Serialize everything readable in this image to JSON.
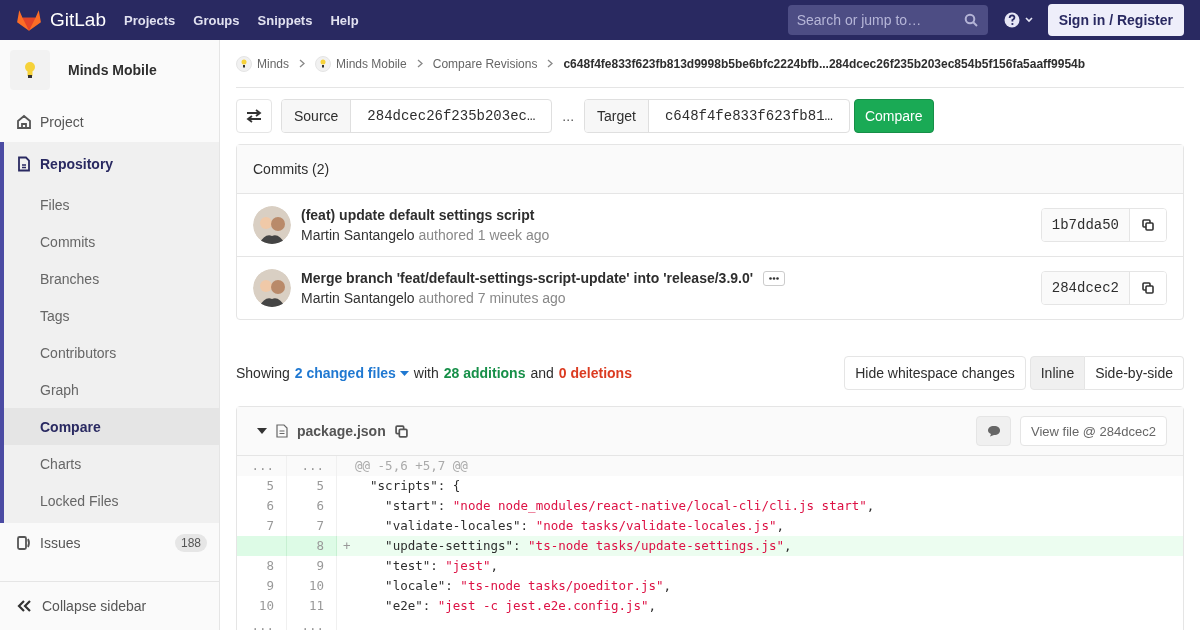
{
  "navbar": {
    "brand": "GitLab",
    "links": [
      "Projects",
      "Groups",
      "Snippets",
      "Help"
    ],
    "search": {
      "placeholder": "Search or jump to…"
    },
    "sign_in": "Sign in / Register"
  },
  "sidebar": {
    "project": "Minds Mobile",
    "items": [
      {
        "label": "Project",
        "selected": false
      },
      {
        "label": "Repository",
        "selected": true,
        "children": [
          {
            "label": "Files",
            "selected": false
          },
          {
            "label": "Commits",
            "selected": false
          },
          {
            "label": "Branches",
            "selected": false
          },
          {
            "label": "Tags",
            "selected": false
          },
          {
            "label": "Contributors",
            "selected": false
          },
          {
            "label": "Graph",
            "selected": false
          },
          {
            "label": "Compare",
            "selected": true
          },
          {
            "label": "Charts",
            "selected": false
          },
          {
            "label": "Locked Files",
            "selected": false
          }
        ]
      },
      {
        "label": "Issues",
        "selected": false,
        "count": "188"
      }
    ],
    "collapse": "Collapse sidebar"
  },
  "breadcrumbs": [
    {
      "label": "Minds",
      "kind": "project"
    },
    {
      "label": "Minds Mobile",
      "kind": "project"
    },
    {
      "label": "Compare Revisions",
      "kind": "link"
    },
    {
      "label": "c648f4fe833f623fb813d9998b5be6bfc2224bfb...284dcec26f235b203ec854b5f156fa5aaff9954b",
      "kind": "current"
    }
  ],
  "compare": {
    "source_label": "Source",
    "source_value": "284dcec26f235b203ec…",
    "separator": "...",
    "target_label": "Target",
    "target_value": "c648f4fe833f623fb81…",
    "button": "Compare"
  },
  "commits": {
    "title": "Commits (2)",
    "items": [
      {
        "title": "(feat) update default settings script",
        "author": "Martin Santangelo",
        "verb": "authored",
        "time": "1 week ago",
        "sha": "1b7dda50",
        "has_more": false
      },
      {
        "title": "Merge branch 'feat/default-settings-script-update' into 'release/3.9.0'",
        "author": "Martin Santangelo",
        "verb": "authored",
        "time": "7 minutes ago",
        "sha": "284dcec2",
        "has_more": true
      }
    ]
  },
  "summary": {
    "showing": "Showing",
    "files": "2 changed files",
    "with": "with",
    "additions": "28 additions",
    "and": "and",
    "deletions": "0 deletions"
  },
  "whitespace_button": "Hide whitespace changes",
  "view_modes": [
    {
      "label": "Inline",
      "selected": true
    },
    {
      "label": "Side-by-side",
      "selected": false
    }
  ],
  "file": {
    "name": "package.json",
    "expanded": true,
    "view_file": "View file @ 284dcec2",
    "lines": [
      {
        "kind": "hunk",
        "old": "...",
        "new": "...",
        "parts": [
          {
            "kind": "plain",
            "text": "@@ -5,6 +5,7 @@"
          }
        ]
      },
      {
        "kind": "context",
        "old": "5",
        "new": "5",
        "parts": [
          {
            "kind": "plain",
            "text": "  \"scripts\": {"
          }
        ]
      },
      {
        "kind": "context",
        "old": "6",
        "new": "6",
        "parts": [
          {
            "kind": "plain",
            "text": "    \"start\": "
          },
          {
            "kind": "string",
            "text": "\"node node_modules/react-native/local-cli/cli.js start\""
          },
          {
            "kind": "plain",
            "text": ","
          }
        ]
      },
      {
        "kind": "context",
        "old": "7",
        "new": "7",
        "parts": [
          {
            "kind": "plain",
            "text": "    \"validate-locales\": "
          },
          {
            "kind": "string",
            "text": "\"node tasks/validate-locales.js\""
          },
          {
            "kind": "plain",
            "text": ","
          }
        ]
      },
      {
        "kind": "added",
        "new": "8",
        "marker": "+",
        "parts": [
          {
            "kind": "plain",
            "text": "    \"update-settings\": "
          },
          {
            "kind": "string",
            "text": "\"ts-node tasks/update-settings.js\""
          },
          {
            "kind": "plain",
            "text": ","
          }
        ]
      },
      {
        "kind": "context",
        "old": "8",
        "new": "9",
        "parts": [
          {
            "kind": "plain",
            "text": "    \"test\": "
          },
          {
            "kind": "string",
            "text": "\"jest\""
          },
          {
            "kind": "plain",
            "text": ","
          }
        ]
      },
      {
        "kind": "context",
        "old": "9",
        "new": "10",
        "parts": [
          {
            "kind": "plain",
            "text": "    \"locale\": "
          },
          {
            "kind": "string",
            "text": "\"ts-node tasks/poeditor.js\""
          },
          {
            "kind": "plain",
            "text": ","
          }
        ]
      },
      {
        "kind": "context",
        "old": "10",
        "new": "11",
        "parts": [
          {
            "kind": "plain",
            "text": "    \"e2e\": "
          },
          {
            "kind": "string",
            "text": "\"jest -c jest.e2e.config.js\""
          },
          {
            "kind": "plain",
            "text": ","
          }
        ]
      },
      {
        "kind": "ellipsis",
        "old": "...",
        "new": "..."
      }
    ]
  }
}
